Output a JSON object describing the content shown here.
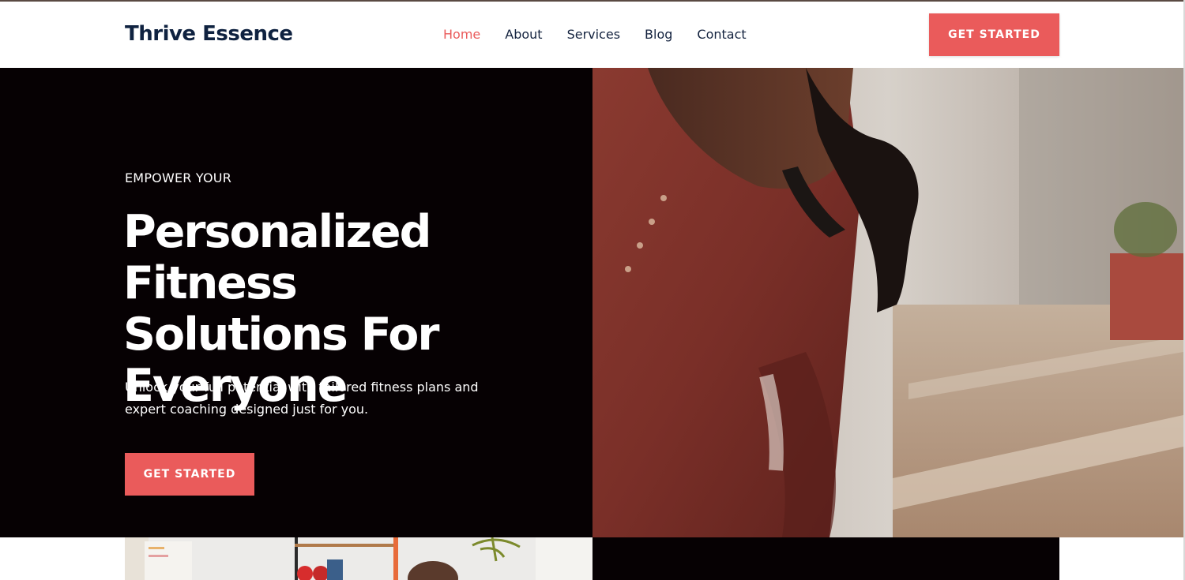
{
  "header": {
    "logo": "Thrive Essence",
    "nav": [
      {
        "label": "Home",
        "active": true
      },
      {
        "label": "About",
        "active": false
      },
      {
        "label": "Services",
        "active": false
      },
      {
        "label": "Blog",
        "active": false
      },
      {
        "label": "Contact",
        "active": false
      }
    ],
    "cta_label": "GET STARTED"
  },
  "hero": {
    "eyebrow": "EMPOWER YOUR",
    "headline_line1": "Personalized Fitness",
    "headline_line2": "Solutions For",
    "headline_line3": "Everyone",
    "subtext": "Unlock your full potential with tailored fitness plans and expert coaching designed just for you.",
    "cta_label": "GET STARTED",
    "image_icon": "woman-exercising-photo"
  },
  "bottom": {
    "image_icon": "gym-interior-photo"
  },
  "colors": {
    "accent": "#ea5b5b",
    "dark_bg": "#060103",
    "nav_text": "#14233f",
    "logo_text": "#0f2240"
  }
}
